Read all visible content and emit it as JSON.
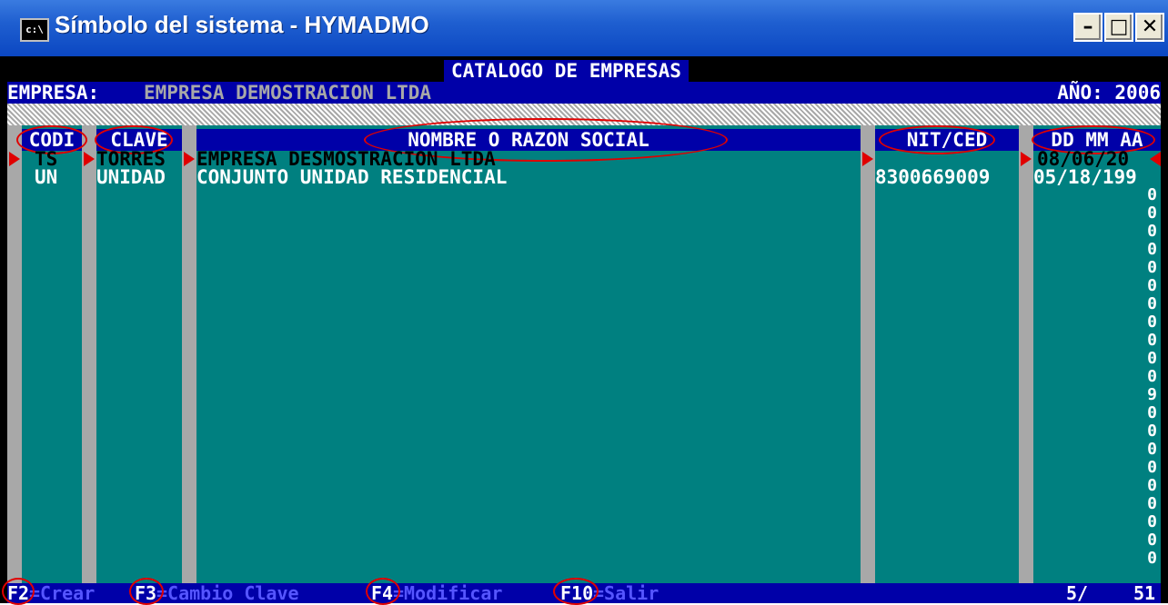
{
  "window": {
    "title": "Símbolo del sistema - HYMADMO",
    "icon_text": "c:\\",
    "min_glyph": "–",
    "max_glyph": "□",
    "close_glyph": "✕"
  },
  "screen": {
    "title": "CATALOGO DE EMPRESAS",
    "empresa_label": "EMPRESA:",
    "empresa_name": "EMPRESA DEMOSTRACION LTDA",
    "year_label": "AÑO: 2006"
  },
  "table": {
    "headers": {
      "codi": "CODI",
      "clave": "CLAVE",
      "nombre": "NOMBRE O RAZON SOCIAL",
      "nit": "NIT/CED",
      "fecha": "DD MM AA"
    },
    "rows": [
      {
        "codi": "TS",
        "clave": "TORRES",
        "nombre": "EMPRESA DESMOSTRACION LTDA",
        "nit": "",
        "fecha": "08/06/20"
      },
      {
        "codi": "UN",
        "clave": "UNIDAD",
        "nombre": "CONJUNTO UNIDAD RESIDENCIAL",
        "nit": "8300669009",
        "fecha": "05/18/199"
      }
    ],
    "right_column_digits": [
      "0",
      "0",
      "0",
      "0",
      "0",
      "0",
      "0",
      "0",
      "0",
      "0",
      "0",
      "9",
      "0",
      "0",
      "0",
      "0",
      "0",
      "0",
      "0",
      "0",
      "0"
    ]
  },
  "footer": {
    "f2_key": "F2",
    "f2_label": "=Crear",
    "f3_key": "F3",
    "f3_label": "=Cambio Clave",
    "f4_key": "F4",
    "f4_label": "=Modificar",
    "f10_key": "F10",
    "f10_label": "=Salir",
    "count_current": "5/",
    "count_total": "51"
  },
  "colors": {
    "console_bg": "#000000",
    "grid_bg": "#008080",
    "bar_bg": "#0000A8",
    "annotation": "#E00000"
  }
}
